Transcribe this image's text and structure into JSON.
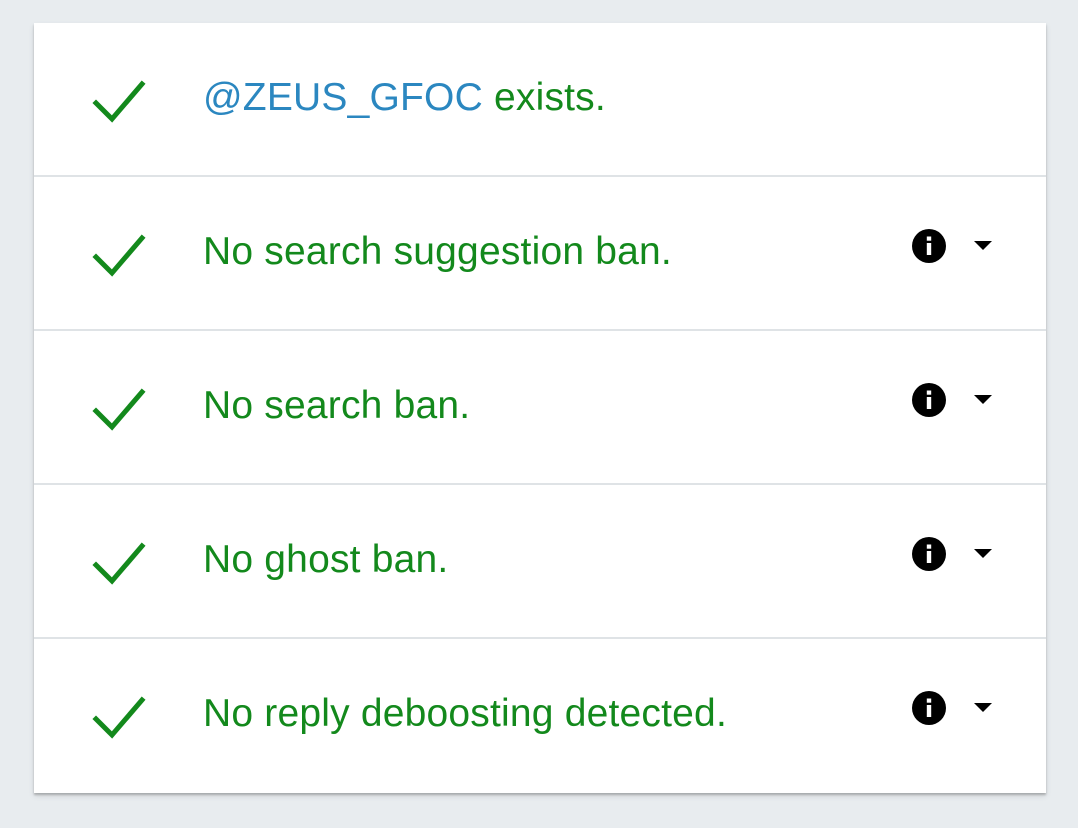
{
  "results": [
    {
      "handle": "@ZEUS_GFOC",
      "text": " exists.",
      "status": "ok",
      "has_details": false
    },
    {
      "handle": "",
      "text": "No search suggestion ban.",
      "status": "ok",
      "has_details": true
    },
    {
      "handle": "",
      "text": "No search ban.",
      "status": "ok",
      "has_details": true
    },
    {
      "handle": "",
      "text": "No ghost ban.",
      "status": "ok",
      "has_details": true
    },
    {
      "handle": "",
      "text": "No reply deboosting detected.",
      "status": "ok",
      "has_details": true
    }
  ],
  "icons": {
    "status_ok": "check-icon",
    "info": "info-icon",
    "expand": "caret-down-icon"
  },
  "colors": {
    "ok_green": "#13891c",
    "handle_blue": "#2b87c0",
    "icon_black": "#000000",
    "page_bg": "#e8ecef",
    "card_bg": "#ffffff"
  }
}
